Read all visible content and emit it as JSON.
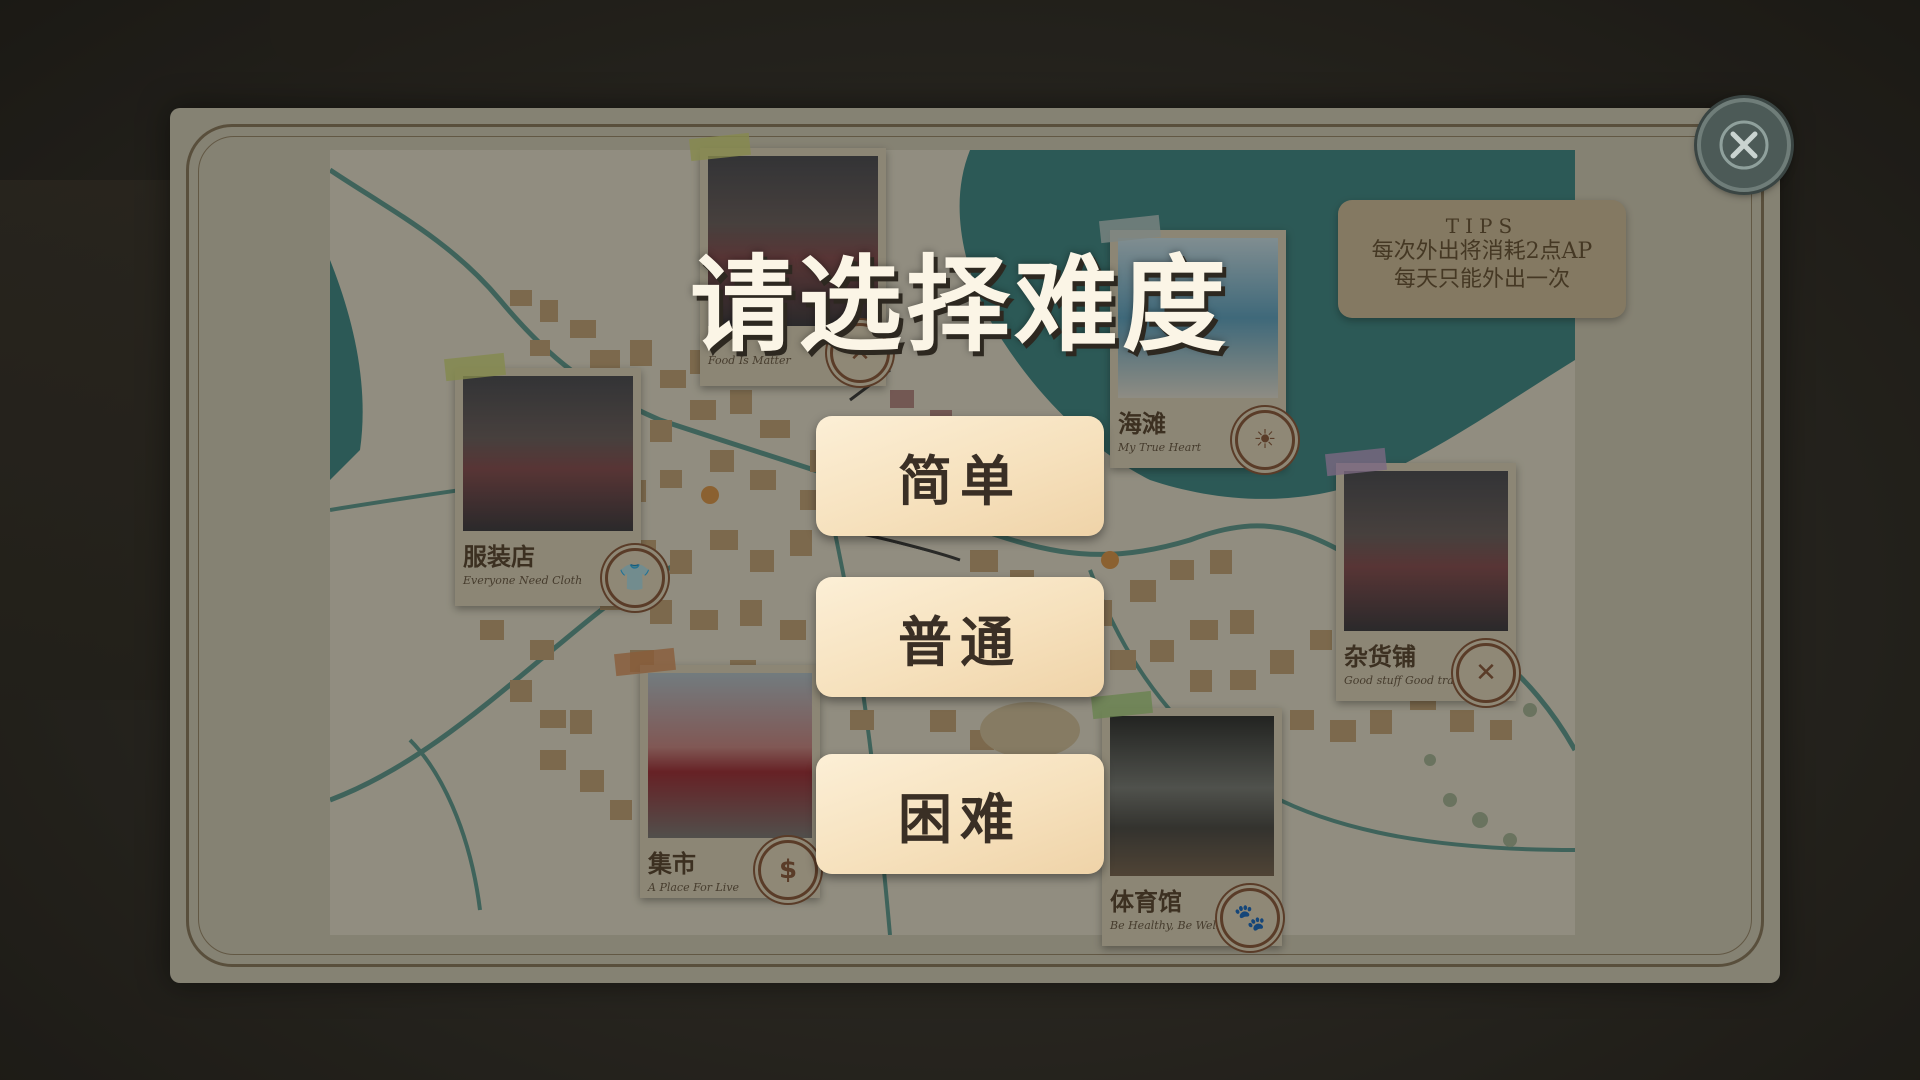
{
  "dialog": {
    "title": "请选择难度"
  },
  "difficulty": {
    "easy": "简单",
    "normal": "普通",
    "hard": "困难"
  },
  "tips": {
    "title": "TIPS",
    "line1": "每次外出将消耗2点AP",
    "line2": "每天只能外出一次"
  },
  "locations": {
    "clothing": {
      "name": "服装店",
      "subtitle": "Everyone Need Cloth",
      "icon": "shirt-icon"
    },
    "top": {
      "subtitle": "Food Is Matter",
      "icon": "utensils-icon"
    },
    "beach": {
      "name": "海滩",
      "subtitle": "My True Heart",
      "icon": "sun-icon"
    },
    "grocery": {
      "name": "杂货铺",
      "subtitle": "Good stuff Good trade",
      "icon": "tools-icon"
    },
    "market": {
      "name": "集市",
      "subtitle": "A Place For Live",
      "icon": "dollar-icon",
      "badge": "$"
    },
    "gym": {
      "name": "体育馆",
      "subtitle": "Be Healthy, Be Well",
      "icon": "paw-icon"
    }
  },
  "colors": {
    "button_bg": "#f6e1bd",
    "button_text": "#3a2f25",
    "title_text": "#fbf5e6",
    "sea": "#3f8c8a",
    "close_button": "#4c5a57"
  }
}
